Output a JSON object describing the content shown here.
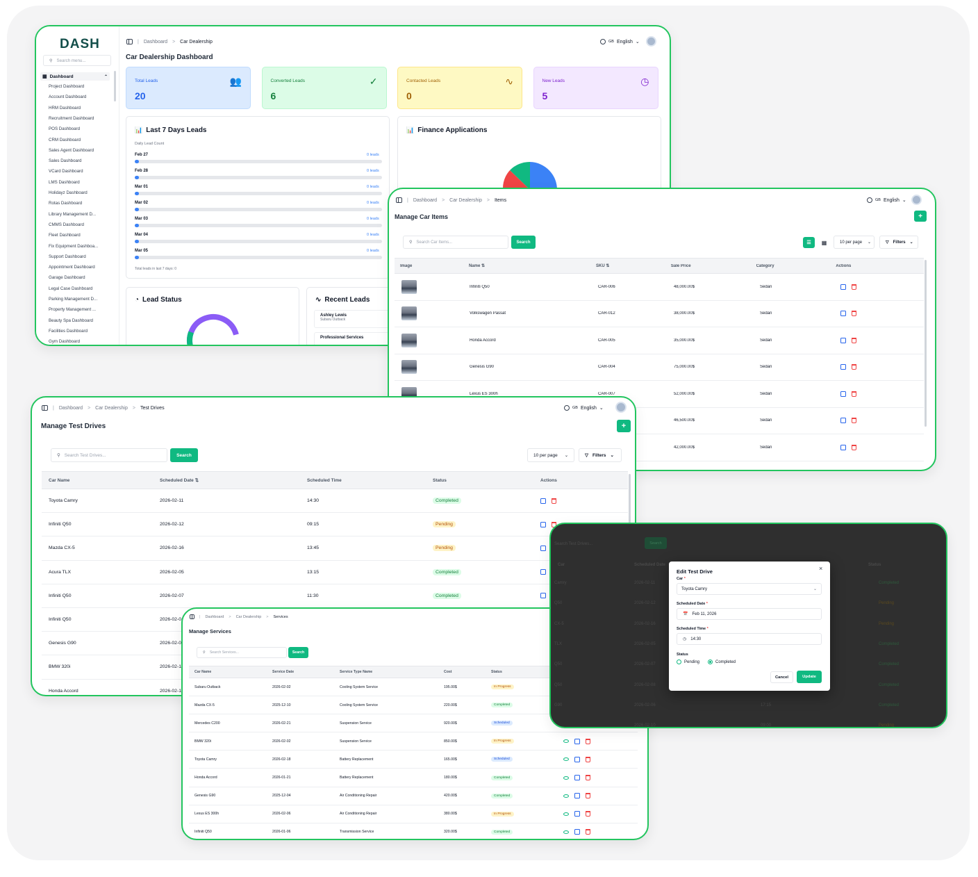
{
  "accent": "#10b981",
  "dashboard": {
    "logo": "DASH",
    "search_placeholder": "Search menu...",
    "nav_group": "Dashboard",
    "nav_items": [
      "Project Dashboard",
      "Account Dashboard",
      "HRM Dashboard",
      "Recruitment Dashboard",
      "POS Dashboard",
      "CRM Dashboard",
      "Sales Agent Dashboard",
      "Sales Dashboard",
      "VCard Dashboard",
      "LMS Dashboard",
      "Holidayz Dashboard",
      "Rotas Dashboard",
      "Library Management D...",
      "CMMS Dashboard",
      "Fleet Dashboard",
      "Fix Equipment Dashboa...",
      "Support Dashboard",
      "Appointment Dashboard",
      "Garage Dashboard",
      "Legal Case Dashboard",
      "Parking Management D...",
      "Property Management ...",
      "Beauty Spa Dashboard",
      "Facilities Dashboard",
      "Gym Dashboard"
    ],
    "breadcrumb": [
      "Dashboard",
      "Car Dealership"
    ],
    "language_code": "GB",
    "language": "English",
    "title": "Car Dealership Dashboard",
    "stats": [
      {
        "label": "Total Leads",
        "value": "20",
        "icon": "users-icon",
        "color": "#2563eb"
      },
      {
        "label": "Converted Leads",
        "value": "6",
        "icon": "check-circle-icon",
        "color": "#15803d"
      },
      {
        "label": "Contacted Leads",
        "value": "0",
        "icon": "activity-icon",
        "color": "#a16207"
      },
      {
        "label": "New Leads",
        "value": "5",
        "icon": "clock-icon",
        "color": "#7e22ce"
      }
    ],
    "last7": {
      "title": "Last 7 Days Leads",
      "subtitle": "Daily Lead Count",
      "rows": [
        {
          "date": "Feb 27",
          "count": "0 leads"
        },
        {
          "date": "Feb 28",
          "count": "0 leads"
        },
        {
          "date": "Mar 01",
          "count": "0 leads"
        },
        {
          "date": "Mar 02",
          "count": "0 leads"
        },
        {
          "date": "Mar 03",
          "count": "0 leads"
        },
        {
          "date": "Mar 04",
          "count": "0 leads"
        },
        {
          "date": "Mar 05",
          "count": "0 leads"
        }
      ],
      "footer": "Total leads in last 7 days: 0"
    },
    "finance_title": "Finance Applications",
    "lead_status_title": "Lead Status",
    "recent_leads": {
      "title": "Recent Leads",
      "items": [
        {
          "name": "Ashley Lewis",
          "car": "Subaru Outback"
        },
        {
          "name": "Professional Services",
          "car": ""
        }
      ]
    }
  },
  "items_screen": {
    "breadcrumb": [
      "Dashboard",
      "Car Dealership",
      "Items"
    ],
    "language_code": "GB",
    "language": "English",
    "title": "Manage Car Items",
    "add_label": "+",
    "search_placeholder": "Search Car Items...",
    "search_label": "Search",
    "per_page": "10 per page",
    "filters_label": "Filters",
    "columns": [
      "Image",
      "Name ⇅",
      "SKU ⇅",
      "Sale Price",
      "Category",
      "Actions"
    ],
    "rows": [
      {
        "name": "Infiniti Q50",
        "sku": "CAR-006",
        "price": "48,000.00$",
        "category": "Sedan"
      },
      {
        "name": "Volkswagen Passat",
        "sku": "CAR-012",
        "price": "38,000.00$",
        "category": "Sedan"
      },
      {
        "name": "Honda Accord",
        "sku": "CAR-005",
        "price": "35,000.00$",
        "category": "Sedan"
      },
      {
        "name": "Genesis G90",
        "sku": "CAR-004",
        "price": "75,000.00$",
        "category": "Sedan"
      },
      {
        "name": "Lexus ES 300h",
        "sku": "CAR-007",
        "price": "52,000.00$",
        "category": "Sedan"
      },
      {
        "name": "",
        "sku": "",
        "price": "46,500.00$",
        "category": "Sedan"
      },
      {
        "name": "",
        "sku": "",
        "price": "42,000.00$",
        "category": "Sedan"
      }
    ]
  },
  "test_drives": {
    "breadcrumb": [
      "Dashboard",
      "Car Dealership",
      "Test Drives"
    ],
    "language_code": "GB",
    "language": "English",
    "title": "Manage Test Drives",
    "add_label": "+",
    "search_placeholder": "Search Test Drives...",
    "search_label": "Search",
    "per_page": "10 per page",
    "filters_label": "Filters",
    "columns": [
      "Car Name",
      "Scheduled Date ⇅",
      "Scheduled Time",
      "Status",
      "Actions"
    ],
    "rows": [
      {
        "car": "Toyota Camry",
        "date": "2026-02-11",
        "time": "14:30",
        "status": "Completed"
      },
      {
        "car": "Infiniti Q50",
        "date": "2026-02-12",
        "time": "09:15",
        "status": "Pending"
      },
      {
        "car": "Mazda CX-5",
        "date": "2026-02-16",
        "time": "13:45",
        "status": "Pending"
      },
      {
        "car": "Acura TLX",
        "date": "2026-02-05",
        "time": "13:15",
        "status": "Completed"
      },
      {
        "car": "Infiniti Q50",
        "date": "2026-02-07",
        "time": "11:30",
        "status": "Completed"
      },
      {
        "car": "Infiniti Q50",
        "date": "2026-02-0",
        "time": "",
        "status": ""
      },
      {
        "car": "Genesis G90",
        "date": "2026-02-0",
        "time": "",
        "status": ""
      },
      {
        "car": "BMW 320i",
        "date": "2026-02-1",
        "time": "",
        "status": ""
      },
      {
        "car": "Honda Accord",
        "date": "2026-02-1",
        "time": "",
        "status": ""
      }
    ]
  },
  "services": {
    "breadcrumb": [
      "Dashboard",
      "Car Dealership",
      "Services"
    ],
    "title": "Manage Services",
    "search_placeholder": "Search Services...",
    "search_label": "Search",
    "columns": [
      "Car Name",
      "Service Date",
      "Service Type Name",
      "Cost",
      "Status"
    ],
    "rows": [
      {
        "car": "Subaru Outback",
        "date": "2026-02-02",
        "type": "Cooling System Service",
        "cost": "195.00$",
        "status": "In Progress"
      },
      {
        "car": "Mazda CX-5",
        "date": "2025-12-10",
        "type": "Cooling System Service",
        "cost": "220.00$",
        "status": "Completed"
      },
      {
        "car": "Mercedes C200",
        "date": "2026-02-21",
        "type": "Suspension Service",
        "cost": "920.00$",
        "status": "Scheduled"
      },
      {
        "car": "BMW 320i",
        "date": "2026-02-02",
        "type": "Suspension Service",
        "cost": "850.00$",
        "status": "In Progress"
      },
      {
        "car": "Toyota Camry",
        "date": "2026-02-18",
        "type": "Battery Replacement",
        "cost": "165.00$",
        "status": "Scheduled"
      },
      {
        "car": "Honda Accord",
        "date": "2026-01-21",
        "type": "Battery Replacement",
        "cost": "180.00$",
        "status": "Completed"
      },
      {
        "car": "Genesis G90",
        "date": "2025-12-04",
        "type": "Air Conditioning Repair",
        "cost": "420.00$",
        "status": "Completed"
      },
      {
        "car": "Lexus ES 300h",
        "date": "2026-02-06",
        "type": "Air Conditioning Repair",
        "cost": "380.00$",
        "status": "In Progress"
      },
      {
        "car": "Infiniti Q50",
        "date": "2026-01-06",
        "type": "Transmission Service",
        "cost": "320.00$",
        "status": "Completed"
      }
    ]
  },
  "modal_screen": {
    "bg_search_placeholder": "Search Test Drives...",
    "bg_search_label": "Search",
    "bg_columns": [
      "Car",
      "Scheduled Date",
      "Status"
    ],
    "bg_rows": [
      {
        "car": "Camry",
        "date": "2026-02-11",
        "time": "",
        "status": "Completed"
      },
      {
        "car": "Q50",
        "date": "2026-02-12",
        "time": "",
        "status": "Pending"
      },
      {
        "car": "CX-5",
        "date": "2026-02-16",
        "time": "",
        "status": "Pending"
      },
      {
        "car": "TLX",
        "date": "2026-02-05",
        "time": "",
        "status": "Completed"
      },
      {
        "car": "Q50",
        "date": "2026-02-07",
        "time": "",
        "status": "Completed"
      },
      {
        "car": "Q50",
        "date": "2026-02-08",
        "time": "",
        "status": "Completed"
      },
      {
        "car": "G90",
        "date": "2026-02-06",
        "time": "17:15",
        "status": "Completed"
      },
      {
        "car": "",
        "date": "2026-02-10",
        "time": "09:00",
        "status": "Pending"
      }
    ],
    "dialog": {
      "title": "Edit Test Drive",
      "car_label": "Car",
      "car_value": "Toyota Camry",
      "date_label": "Scheduled Date",
      "date_value": "Feb 11, 2026",
      "time_label": "Scheduled Time",
      "time_value": "14:30",
      "required_mark": "*",
      "status_label": "Status",
      "options": [
        "Pending",
        "Completed"
      ],
      "selected": "Completed",
      "cancel_label": "Cancel",
      "update_label": "Update",
      "close_glyph": "×"
    }
  }
}
